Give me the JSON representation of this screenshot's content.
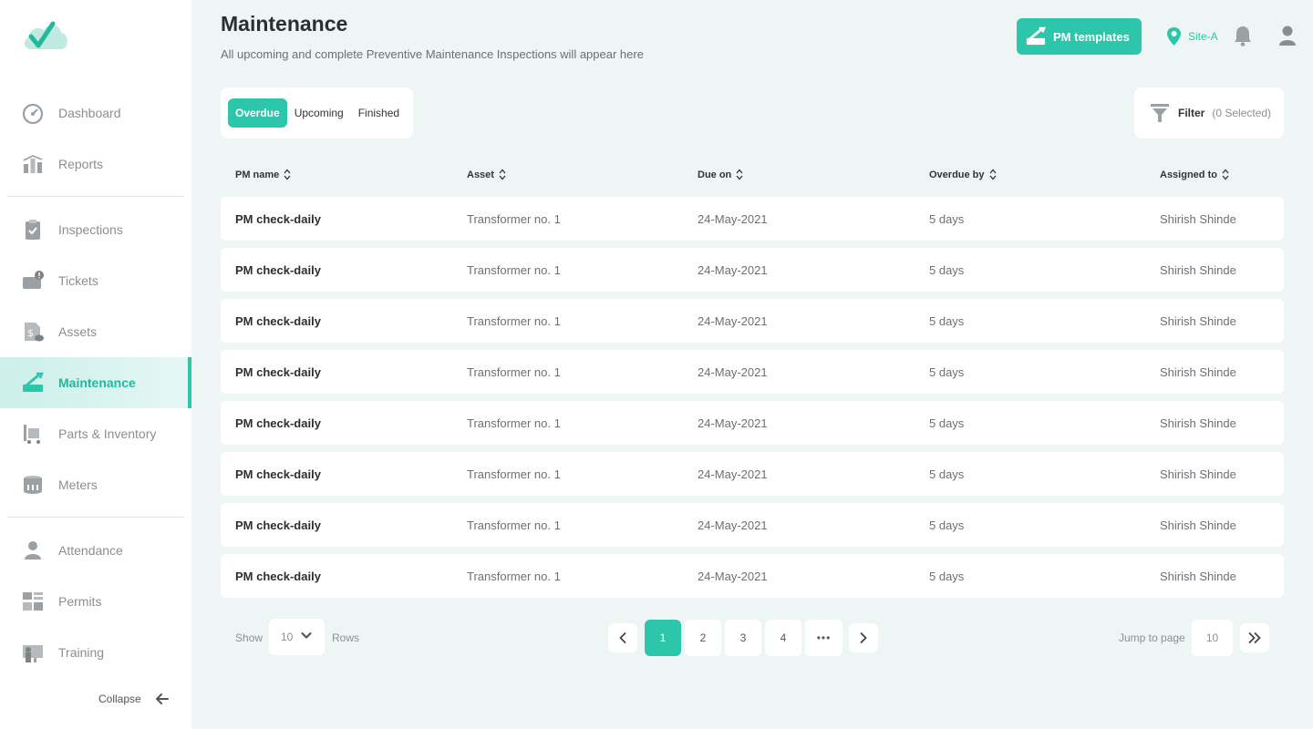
{
  "sidebar": {
    "items": [
      {
        "label": "Dashboard",
        "icon": "dashboard-icon"
      },
      {
        "label": "Reports",
        "icon": "reports-icon"
      },
      {
        "label": "Inspections",
        "icon": "inspections-icon"
      },
      {
        "label": "Tickets",
        "icon": "tickets-icon"
      },
      {
        "label": "Assets",
        "icon": "assets-icon"
      },
      {
        "label": "Maintenance",
        "icon": "maintenance-icon",
        "active": true
      },
      {
        "label": "Parts & Inventory",
        "icon": "parts-inventory-icon"
      },
      {
        "label": "Meters",
        "icon": "meters-icon"
      },
      {
        "label": "Attendance",
        "icon": "attendance-icon"
      },
      {
        "label": "Permits",
        "icon": "permits-icon"
      },
      {
        "label": "Training",
        "icon": "training-icon"
      }
    ],
    "collapse_label": "Collapse"
  },
  "header": {
    "title": "Maintenance",
    "subtitle": "All upcoming and complete Preventive Maintenance Inspections will appear here",
    "pm_templates_label": "PM templates",
    "site_label": "Site-A"
  },
  "tabs": [
    {
      "label": "Overdue",
      "active": true
    },
    {
      "label": "Upcoming"
    },
    {
      "label": "Finished"
    }
  ],
  "filter": {
    "label": "Filter",
    "count": "(0 Selected)"
  },
  "table": {
    "columns": [
      "PM name",
      "Asset",
      "Due on",
      "Overdue by",
      "Assigned to"
    ],
    "rows": [
      [
        "PM check-daily",
        "Transformer no. 1",
        "24-May-2021",
        "5 days",
        "Shirish Shinde"
      ],
      [
        "PM check-daily",
        "Transformer no. 1",
        "24-May-2021",
        "5 days",
        "Shirish Shinde"
      ],
      [
        "PM check-daily",
        "Transformer no. 1",
        "24-May-2021",
        "5 days",
        "Shirish Shinde"
      ],
      [
        "PM check-daily",
        "Transformer no. 1",
        "24-May-2021",
        "5 days",
        "Shirish Shinde"
      ],
      [
        "PM check-daily",
        "Transformer no. 1",
        "24-May-2021",
        "5 days",
        "Shirish Shinde"
      ],
      [
        "PM check-daily",
        "Transformer no. 1",
        "24-May-2021",
        "5 days",
        "Shirish Shinde"
      ],
      [
        "PM check-daily",
        "Transformer no. 1",
        "24-May-2021",
        "5 days",
        "Shirish Shinde"
      ],
      [
        "PM check-daily",
        "Transformer no. 1",
        "24-May-2021",
        "5 days",
        "Shirish Shinde"
      ]
    ]
  },
  "pagination": {
    "show_label": "Show",
    "rows_value": "10",
    "rows_label": "Rows",
    "pages": [
      "1",
      "2",
      "3",
      "4"
    ],
    "current_page": "1",
    "ellipsis": "•••",
    "jump_label": "Jump to page",
    "jump_value": "10"
  },
  "colors": {
    "accent": "#2ec6aa",
    "background": "#eef6f5",
    "muted": "#8a8f93"
  }
}
